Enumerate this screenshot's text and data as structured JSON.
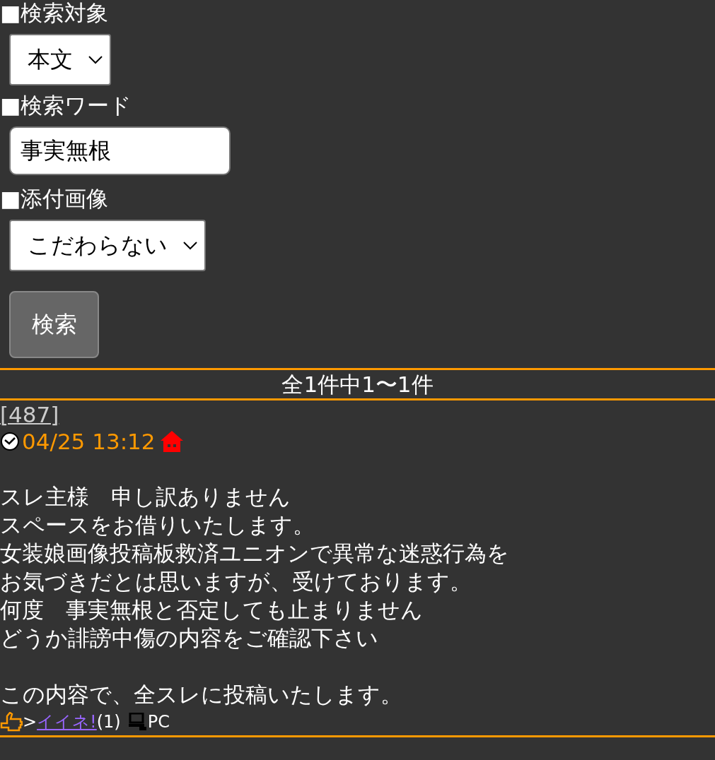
{
  "search_form": {
    "fields": [
      {
        "kind": "select",
        "label": "■検索対象",
        "value": "本文"
      },
      {
        "kind": "text",
        "label": "■検索ワード",
        "value": "事実無根"
      },
      {
        "kind": "select",
        "label": "■添付画像",
        "value": "こだわらない"
      }
    ],
    "submit": "検索"
  },
  "result_count": "全1件中1〜1件",
  "posts": [
    {
      "number": "[487]",
      "date": "04/25 13:12",
      "message_paragraphs": [
        [
          "スレ主様　申し訳ありません",
          "スペースをお借りいたします。",
          "女装娘画像投稿板救済ユニオンで異常な迷惑行為を",
          "お気づきだとは思いますが、受けております。",
          "何度　事実無根と否定しても止まりません",
          "どうか誹謗中傷の内容をご確認下さい"
        ],
        [
          "この内容で、全スレに投稿いたします。"
        ]
      ],
      "like_prefix": ">",
      "like_link": "イイネ!",
      "like_count": "(1)",
      "device": "PC"
    }
  ]
}
